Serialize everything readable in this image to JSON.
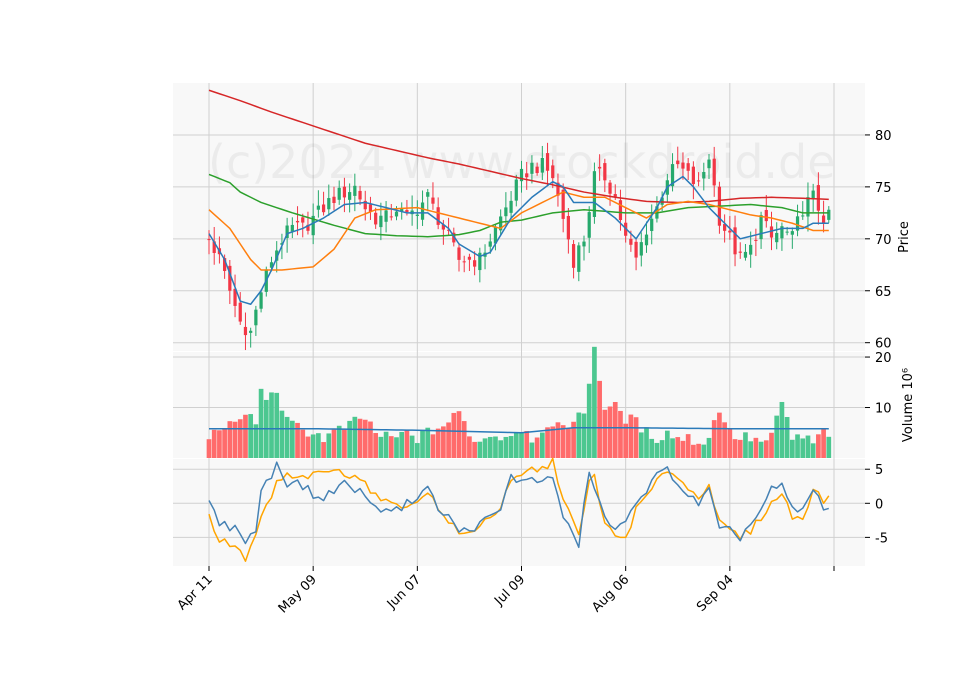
{
  "watermark": "(c)2024 www.stockdroid.de",
  "colors": {
    "up": "#26a96c",
    "down": "#f23645",
    "up_volume": "#4cc790",
    "down_volume": "#ff6b6b",
    "ma_short": "#2a7ab9",
    "ma_mid": "#ff7f0e",
    "ma_long": "#2ca02c",
    "ma_longest": "#d62728",
    "vol_ma": "#2a7ab9",
    "osc_a": "#4682b4",
    "osc_b": "#ffa500",
    "panel_bg": "#f8f8f8",
    "grid": "#d0d0d0"
  },
  "chart_data": {
    "type": "candlestick",
    "x_ticks": [
      "Apr 11",
      "May 09",
      "Jun 07",
      "Jul 09",
      "Aug 06",
      "Sep 04",
      ""
    ],
    "x_tick_index": [
      0,
      20,
      40,
      60,
      80,
      100,
      120
    ],
    "n_bars": 120,
    "price_panel": {
      "ylabel": "Price",
      "ylim": [
        59.2,
        85
      ],
      "yticks": [
        60,
        65,
        70,
        75,
        80
      ]
    },
    "volume_panel": {
      "ylabel": "Volume  10⁶",
      "ylim": [
        0,
        21
      ],
      "yticks": [
        10,
        20
      ]
    },
    "oscillator_panel": {
      "ylabel": "",
      "ylim": [
        -9.2,
        6.5
      ],
      "yticks": [
        -5,
        0,
        5
      ]
    },
    "close_keyframes": [
      [
        0,
        70
      ],
      [
        2,
        68
      ],
      [
        4,
        65
      ],
      [
        6,
        62
      ],
      [
        8,
        61
      ],
      [
        10,
        65
      ],
      [
        12,
        68
      ],
      [
        14,
        70
      ],
      [
        16,
        71
      ],
      [
        18,
        71
      ],
      [
        20,
        72
      ],
      [
        22,
        73
      ],
      [
        24,
        74
      ],
      [
        26,
        74.5
      ],
      [
        28,
        75
      ],
      [
        30,
        73
      ],
      [
        32,
        72
      ],
      [
        34,
        72
      ],
      [
        36,
        73
      ],
      [
        38,
        72
      ],
      [
        40,
        73
      ],
      [
        42,
        74
      ],
      [
        44,
        72
      ],
      [
        46,
        70
      ],
      [
        48,
        68
      ],
      [
        50,
        68
      ],
      [
        52,
        68
      ],
      [
        54,
        70
      ],
      [
        56,
        72
      ],
      [
        58,
        74
      ],
      [
        60,
        76
      ],
      [
        62,
        77
      ],
      [
        64,
        77
      ],
      [
        66,
        76
      ],
      [
        68,
        72
      ],
      [
        70,
        68
      ],
      [
        72,
        70
      ],
      [
        74,
        76
      ],
      [
        76,
        76
      ],
      [
        78,
        74
      ],
      [
        80,
        70
      ],
      [
        82,
        68
      ],
      [
        84,
        71
      ],
      [
        86,
        73
      ],
      [
        88,
        76
      ],
      [
        90,
        77
      ],
      [
        92,
        76
      ],
      [
        94,
        75
      ],
      [
        96,
        78
      ],
      [
        98,
        72
      ],
      [
        100,
        70
      ],
      [
        102,
        68
      ],
      [
        104,
        69
      ],
      [
        106,
        72
      ],
      [
        108,
        70
      ],
      [
        110,
        71
      ],
      [
        112,
        70
      ],
      [
        114,
        73
      ],
      [
        116,
        74
      ],
      [
        118,
        72
      ],
      [
        119,
        72
      ]
    ],
    "ma_keyframes": {
      "ma_short": [
        [
          0,
          70.5
        ],
        [
          3,
          68
        ],
        [
          6,
          64
        ],
        [
          8,
          63.7
        ],
        [
          10,
          65
        ],
        [
          12,
          67
        ],
        [
          15,
          70.5
        ],
        [
          18,
          71
        ],
        [
          22,
          72
        ],
        [
          26,
          73.3
        ],
        [
          30,
          73.5
        ],
        [
          34,
          73
        ],
        [
          38,
          72.5
        ],
        [
          42,
          72.5
        ],
        [
          46,
          71
        ],
        [
          48,
          69.5
        ],
        [
          52,
          68.3
        ],
        [
          54,
          68.7
        ],
        [
          58,
          72
        ],
        [
          62,
          74
        ],
        [
          66,
          75.5
        ],
        [
          68,
          75
        ],
        [
          70,
          73.5
        ],
        [
          74,
          73.5
        ],
        [
          78,
          72
        ],
        [
          82,
          70
        ],
        [
          86,
          73
        ],
        [
          88,
          75
        ],
        [
          91,
          76
        ],
        [
          93,
          75
        ],
        [
          96,
          73
        ],
        [
          100,
          71
        ],
        [
          102,
          70
        ],
        [
          106,
          70.5
        ],
        [
          110,
          71
        ],
        [
          114,
          71
        ],
        [
          116,
          71.5
        ],
        [
          119,
          71.5
        ]
      ],
      "ma_mid": [
        [
          0,
          72.8
        ],
        [
          4,
          71
        ],
        [
          8,
          68
        ],
        [
          10,
          67
        ],
        [
          14,
          67
        ],
        [
          20,
          67.3
        ],
        [
          24,
          69
        ],
        [
          28,
          72
        ],
        [
          32,
          72.8
        ],
        [
          40,
          73
        ],
        [
          44,
          72.5
        ],
        [
          48,
          72
        ],
        [
          52,
          71.5
        ],
        [
          56,
          71
        ],
        [
          60,
          72.5
        ],
        [
          64,
          73.5
        ],
        [
          68,
          74.5
        ],
        [
          72,
          74
        ],
        [
          76,
          74
        ],
        [
          80,
          73
        ],
        [
          84,
          72
        ],
        [
          88,
          73.3
        ],
        [
          92,
          73.6
        ],
        [
          96,
          73.3
        ],
        [
          100,
          72.8
        ],
        [
          104,
          72.3
        ],
        [
          108,
          72
        ],
        [
          112,
          71.5
        ],
        [
          116,
          70.8
        ],
        [
          119,
          70.8
        ]
      ],
      "ma_long": [
        [
          0,
          76.2
        ],
        [
          4,
          75.4
        ],
        [
          6,
          74.5
        ],
        [
          10,
          73.5
        ],
        [
          16,
          72.5
        ],
        [
          24,
          71.3
        ],
        [
          30,
          70.5
        ],
        [
          36,
          70.3
        ],
        [
          42,
          70.2
        ],
        [
          48,
          70.4
        ],
        [
          52,
          70.8
        ],
        [
          56,
          71.6
        ],
        [
          60,
          71.8
        ],
        [
          66,
          72.5
        ],
        [
          72,
          72.8
        ],
        [
          80,
          72.5
        ],
        [
          86,
          72.5
        ],
        [
          92,
          73
        ],
        [
          96,
          73.1
        ],
        [
          100,
          73.2
        ],
        [
          104,
          73.3
        ],
        [
          110,
          73
        ],
        [
          114,
          72.5
        ],
        [
          118,
          72.5
        ],
        [
          119,
          72.5
        ]
      ],
      "ma_longest": [
        [
          0,
          84.3
        ],
        [
          6,
          83.3
        ],
        [
          12,
          82.2
        ],
        [
          18,
          81.2
        ],
        [
          24,
          80.2
        ],
        [
          30,
          79.2
        ],
        [
          36,
          78.5
        ],
        [
          42,
          77.8
        ],
        [
          48,
          77.2
        ],
        [
          54,
          76.5
        ],
        [
          60,
          75.8
        ],
        [
          66,
          75.2
        ],
        [
          72,
          74.5
        ],
        [
          78,
          74
        ],
        [
          84,
          73.6
        ],
        [
          90,
          73.5
        ],
        [
          96,
          73.6
        ],
        [
          102,
          73.9
        ],
        [
          108,
          74
        ],
        [
          114,
          73.9
        ],
        [
          119,
          73.8
        ]
      ]
    },
    "volume_keyframes": [
      [
        0,
        4
      ],
      [
        3,
        7
      ],
      [
        5,
        6
      ],
      [
        7,
        9
      ],
      [
        9,
        7
      ],
      [
        10,
        13
      ],
      [
        12,
        12
      ],
      [
        13,
        13.5
      ],
      [
        15,
        7
      ],
      [
        17,
        6
      ],
      [
        20,
        5
      ],
      [
        22,
        4
      ],
      [
        24,
        5
      ],
      [
        26,
        6
      ],
      [
        28,
        7
      ],
      [
        30,
        8
      ],
      [
        32,
        5
      ],
      [
        34,
        4
      ],
      [
        36,
        4
      ],
      [
        38,
        5
      ],
      [
        40,
        4
      ],
      [
        42,
        5
      ],
      [
        44,
        6
      ],
      [
        46,
        7
      ],
      [
        48,
        9
      ],
      [
        50,
        5
      ],
      [
        52,
        3
      ],
      [
        54,
        5
      ],
      [
        56,
        4
      ],
      [
        58,
        5
      ],
      [
        60,
        6
      ],
      [
        62,
        4
      ],
      [
        64,
        6
      ],
      [
        66,
        5
      ],
      [
        68,
        7
      ],
      [
        70,
        7
      ],
      [
        72,
        9
      ],
      [
        74,
        22
      ],
      [
        76,
        10
      ],
      [
        78,
        10
      ],
      [
        80,
        8
      ],
      [
        82,
        7
      ],
      [
        84,
        5
      ],
      [
        86,
        4
      ],
      [
        88,
        5
      ],
      [
        90,
        4
      ],
      [
        92,
        4
      ],
      [
        94,
        3
      ],
      [
        96,
        4
      ],
      [
        98,
        10
      ],
      [
        100,
        5
      ],
      [
        102,
        4
      ],
      [
        104,
        4
      ],
      [
        106,
        3
      ],
      [
        108,
        4
      ],
      [
        110,
        11
      ],
      [
        112,
        4
      ],
      [
        114,
        4
      ],
      [
        116,
        3
      ],
      [
        118,
        5
      ],
      [
        119,
        5
      ]
    ],
    "vol_ma_keyframes": [
      [
        0,
        5.8
      ],
      [
        20,
        5.8
      ],
      [
        40,
        5.5
      ],
      [
        60,
        5
      ],
      [
        70,
        6
      ],
      [
        80,
        6
      ],
      [
        100,
        5.8
      ],
      [
        119,
        5.8
      ]
    ],
    "osc_a_keyframes": [
      [
        0,
        0.2
      ],
      [
        2,
        -3
      ],
      [
        4,
        -3.5
      ],
      [
        6,
        -4
      ],
      [
        7,
        -5.5
      ],
      [
        9,
        -4
      ],
      [
        10,
        2
      ],
      [
        12,
        4
      ],
      [
        13,
        6
      ],
      [
        15,
        3
      ],
      [
        17,
        3
      ],
      [
        19,
        2
      ],
      [
        20,
        1
      ],
      [
        22,
        0.8
      ],
      [
        24,
        2
      ],
      [
        26,
        3
      ],
      [
        28,
        2
      ],
      [
        30,
        1.5
      ],
      [
        32,
        -1
      ],
      [
        34,
        -0.5
      ],
      [
        36,
        -1
      ],
      [
        38,
        0
      ],
      [
        40,
        1
      ],
      [
        42,
        2.5
      ],
      [
        44,
        -1
      ],
      [
        46,
        -2
      ],
      [
        48,
        -4
      ],
      [
        50,
        -4
      ],
      [
        52,
        -3
      ],
      [
        54,
        -2
      ],
      [
        56,
        -1
      ],
      [
        58,
        4
      ],
      [
        60,
        3
      ],
      [
        62,
        4
      ],
      [
        64,
        3
      ],
      [
        66,
        4
      ],
      [
        68,
        -2
      ],
      [
        70,
        -5
      ],
      [
        71,
        -6
      ],
      [
        73,
        5
      ],
      [
        74,
        2
      ],
      [
        76,
        -2
      ],
      [
        78,
        -4
      ],
      [
        80,
        -3
      ],
      [
        82,
        0.5
      ],
      [
        84,
        2
      ],
      [
        86,
        4
      ],
      [
        88,
        5
      ],
      [
        90,
        3
      ],
      [
        92,
        1
      ],
      [
        94,
        0
      ],
      [
        96,
        2
      ],
      [
        98,
        -4
      ],
      [
        100,
        -4
      ],
      [
        102,
        -5
      ],
      [
        104,
        -3
      ],
      [
        106,
        -1
      ],
      [
        108,
        2
      ],
      [
        110,
        2.5
      ],
      [
        112,
        -1
      ],
      [
        114,
        -1
      ],
      [
        116,
        2
      ],
      [
        118,
        -0.5
      ],
      [
        119,
        -0.5
      ]
    ],
    "osc_b_keyframes": [
      [
        0,
        -2
      ],
      [
        2,
        -5.5
      ],
      [
        4,
        -6
      ],
      [
        6,
        -7
      ],
      [
        7,
        -8.5
      ],
      [
        9,
        -5
      ],
      [
        10,
        -2
      ],
      [
        12,
        1
      ],
      [
        13,
        3
      ],
      [
        15,
        4
      ],
      [
        17,
        3.5
      ],
      [
        19,
        4
      ],
      [
        20,
        4
      ],
      [
        22,
        4.5
      ],
      [
        24,
        5
      ],
      [
        26,
        4
      ],
      [
        28,
        4.5
      ],
      [
        30,
        3
      ],
      [
        32,
        1
      ],
      [
        34,
        0
      ],
      [
        36,
        0.5
      ],
      [
        38,
        -1
      ],
      [
        40,
        0.5
      ],
      [
        42,
        2
      ],
      [
        44,
        -1
      ],
      [
        46,
        -2.5
      ],
      [
        48,
        -4.5
      ],
      [
        50,
        -4.5
      ],
      [
        52,
        -3
      ],
      [
        54,
        -2
      ],
      [
        56,
        -0.5
      ],
      [
        58,
        3
      ],
      [
        60,
        4
      ],
      [
        62,
        5
      ],
      [
        64,
        5
      ],
      [
        66,
        6
      ],
      [
        68,
        1
      ],
      [
        70,
        -3
      ],
      [
        71,
        -5
      ],
      [
        73,
        3
      ],
      [
        74,
        4
      ],
      [
        76,
        -3
      ],
      [
        78,
        -5
      ],
      [
        80,
        -5
      ],
      [
        82,
        -1
      ],
      [
        84,
        1
      ],
      [
        86,
        3
      ],
      [
        88,
        5
      ],
      [
        90,
        4
      ],
      [
        92,
        2
      ],
      [
        94,
        1
      ],
      [
        96,
        3
      ],
      [
        98,
        -3
      ],
      [
        100,
        -4
      ],
      [
        102,
        -5
      ],
      [
        104,
        -4
      ],
      [
        106,
        -2
      ],
      [
        108,
        0
      ],
      [
        110,
        1.5
      ],
      [
        112,
        -2
      ],
      [
        114,
        -2
      ],
      [
        116,
        2
      ],
      [
        118,
        0.5
      ],
      [
        119,
        0.5
      ]
    ]
  }
}
